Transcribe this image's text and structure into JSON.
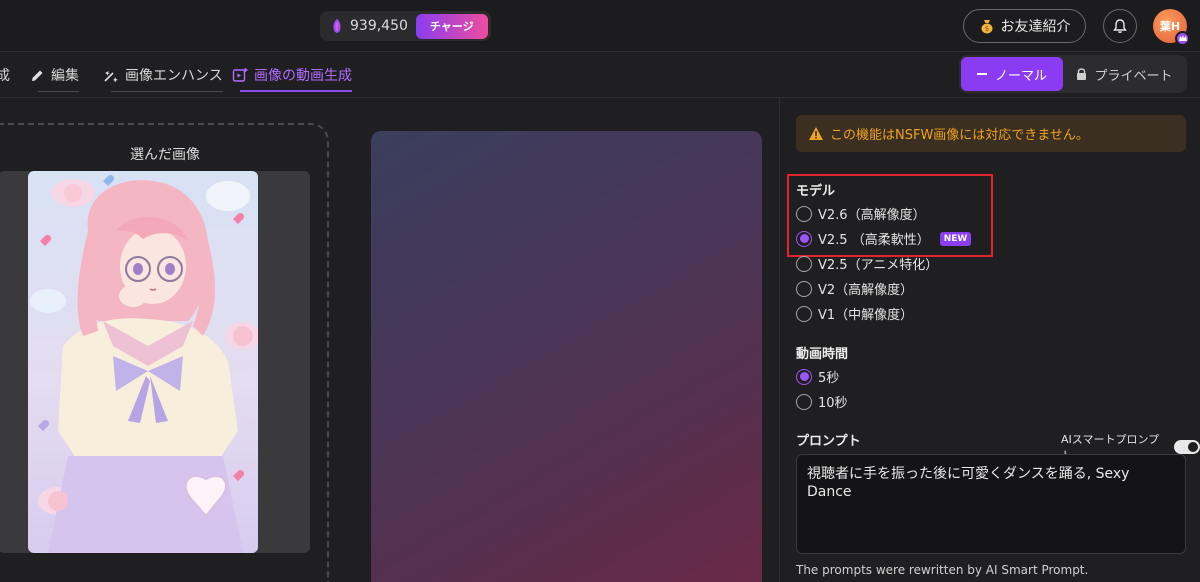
{
  "header": {
    "credits": "939,450",
    "charge_label": "チャージ",
    "invite_label": "お友達紹介",
    "avatar_text": "葉H"
  },
  "tabs": [
    {
      "label": "成"
    },
    {
      "label": "編集"
    },
    {
      "label": "画像エンハンス"
    },
    {
      "label": "画像の動画生成"
    }
  ],
  "mode": {
    "normal_label": "ノーマル",
    "private_label": "プライベート"
  },
  "left_panel": {
    "title": "選んだ画像"
  },
  "settings": {
    "warning": "この機能はNSFW画像には対応できません。",
    "model_title": "モデル",
    "models": [
      {
        "label": "V2.6（高解像度）",
        "checked": false
      },
      {
        "label": "V2.5 （高柔軟性）",
        "checked": true,
        "badge": "NEW"
      },
      {
        "label": "V2.5（アニメ特化）",
        "checked": false
      },
      {
        "label": "V2（高解像度）",
        "checked": false
      },
      {
        "label": "V1（中解像度）",
        "checked": false
      }
    ],
    "duration_title": "動画時間",
    "durations": [
      {
        "label": "5秒",
        "checked": true
      },
      {
        "label": "10秒",
        "checked": false
      }
    ],
    "prompt_title": "プロンプト",
    "smart_prompt_label": "AIスマートプロンプト",
    "smart_prompt_enabled": true,
    "prompt_text": "視聴者に手を振った後に可愛くダンスを踊る, Sexy Dance",
    "prompt_note": "The prompts were rewritten by AI Smart Prompt."
  },
  "colors": {
    "accent": "#8b3cf3",
    "warning": "#f0a224",
    "highlight_box": "#e0262c"
  }
}
